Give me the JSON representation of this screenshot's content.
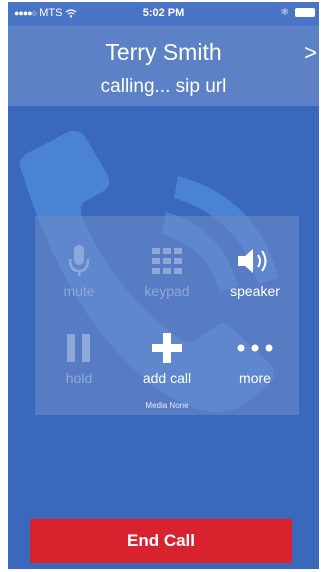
{
  "status_bar": {
    "signal_dots": "●●●●○",
    "carrier": "MTS",
    "time": "5:02 PM",
    "bluetooth_glyph": "✱"
  },
  "call": {
    "contact_name": "Terry Smith",
    "status_text": "calling... sip url"
  },
  "controls": [
    {
      "label": "mute",
      "icon": "microphone-icon",
      "enabled": false
    },
    {
      "label": "keypad",
      "icon": "keypad-grid-icon",
      "enabled": false
    },
    {
      "label": "speaker",
      "icon": "speaker-icon",
      "enabled": true
    },
    {
      "label": "hold",
      "icon": "pause-icon",
      "enabled": false
    },
    {
      "label": "add call",
      "icon": "plus-icon",
      "enabled": true
    },
    {
      "label": "more",
      "icon": "ellipsis-icon",
      "enabled": true
    }
  ],
  "media_status": "Media None",
  "end_call_label": "End Call",
  "colors": {
    "background": "#3a68bd",
    "header": "#5c81c7",
    "end_call": "#d8232f",
    "disabled": "#8ea8d8"
  }
}
